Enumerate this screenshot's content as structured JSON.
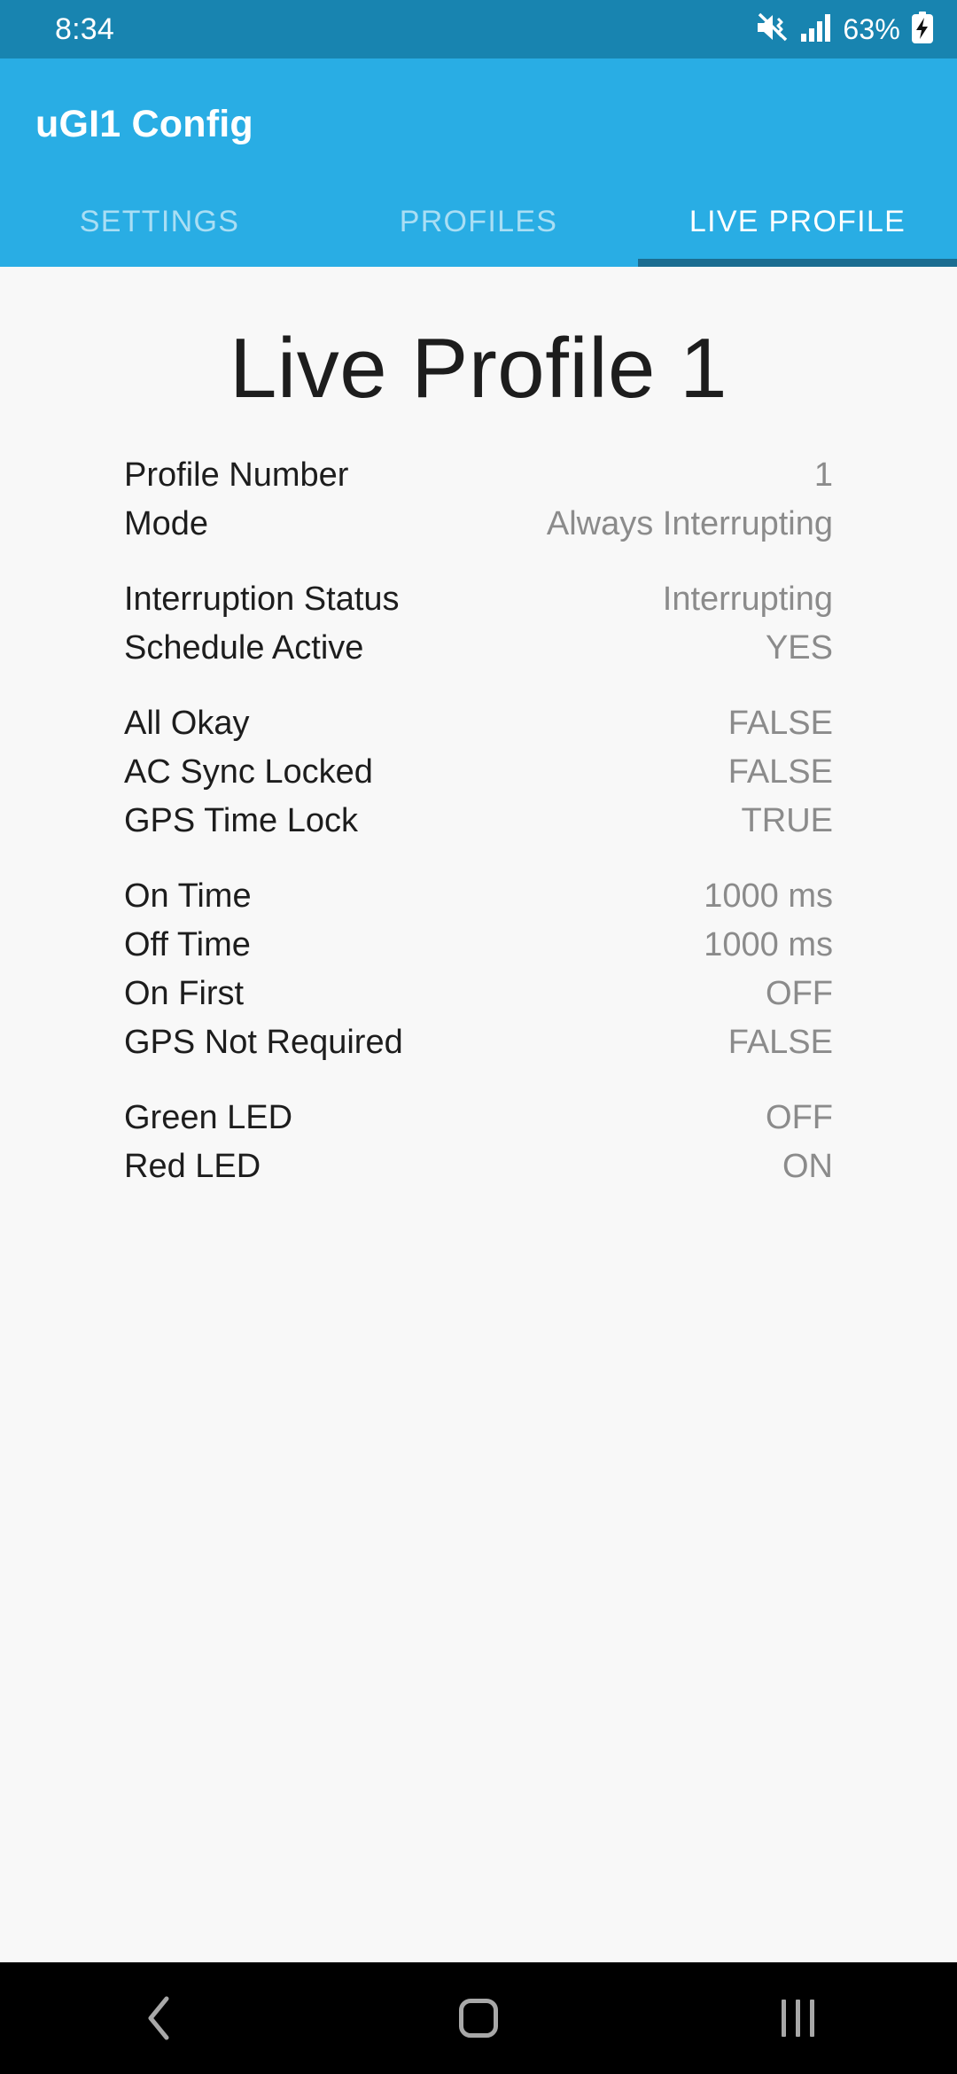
{
  "status_bar": {
    "clock": "8:34",
    "battery_percent": "63%",
    "icons": [
      "mute-vibrate-icon",
      "signal-bars-icon",
      "battery-charging-icon"
    ]
  },
  "app_bar": {
    "title": "uGI1 Config",
    "background_color": "#29ade4",
    "tabs": [
      {
        "label": "SETTINGS",
        "active": false
      },
      {
        "label": "PROFILES",
        "active": false
      },
      {
        "label": "LIVE PROFILE",
        "active": true
      }
    ],
    "active_indicator_color": "#1b6d91"
  },
  "main": {
    "page_title": "Live Profile 1",
    "groups": [
      {
        "rows": [
          {
            "label": "Profile Number",
            "value": "1"
          },
          {
            "label": "Mode",
            "value": "Always Interrupting"
          }
        ]
      },
      {
        "rows": [
          {
            "label": "Interruption Status",
            "value": "Interrupting"
          },
          {
            "label": "Schedule Active",
            "value": "YES"
          }
        ]
      },
      {
        "rows": [
          {
            "label": "All Okay",
            "value": "FALSE"
          },
          {
            "label": "AC Sync Locked",
            "value": "FALSE"
          },
          {
            "label": "GPS Time Lock",
            "value": "TRUE"
          }
        ]
      },
      {
        "rows": [
          {
            "label": "On Time",
            "value": "1000 ms"
          },
          {
            "label": "Off Time",
            "value": "1000 ms"
          },
          {
            "label": "On First",
            "value": "OFF"
          },
          {
            "label": "GPS Not Required",
            "value": "FALSE"
          }
        ]
      },
      {
        "rows": [
          {
            "label": "Green LED",
            "value": "OFF"
          },
          {
            "label": "Red LED",
            "value": "ON"
          }
        ]
      }
    ]
  },
  "nav_bar": {
    "buttons": [
      "back-button",
      "home-button",
      "recents-button"
    ]
  }
}
